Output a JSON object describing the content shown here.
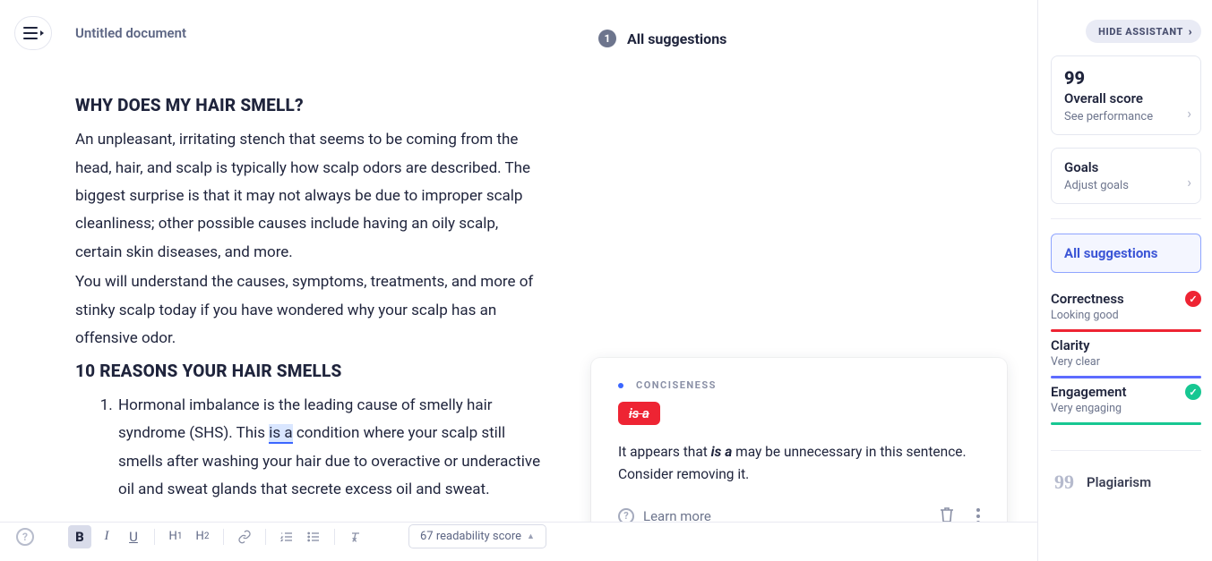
{
  "doc_title": "Untitled document",
  "suggestions_header": {
    "count": "1",
    "label": "All suggestions"
  },
  "editor": {
    "h1": "WHY DOES MY HAIR SMELL?",
    "p1": "An unpleasant, irritating stench that seems to be coming from the head, hair, and scalp is typically how scalp odors are described. The biggest surprise is that it may not always be due to improper scalp cleanliness; other possible causes include having an oily scalp, certain skin diseases, and more.",
    "p2": "You will understand the causes, symptoms, treatments, and more of stinky scalp today if you have wondered why your scalp has an offensive odor.",
    "h2": "10 REASONS YOUR HAIR SMELLS",
    "li1_a": "Hormonal imbalance is the leading cause of smelly hair syndrome (SHS). This ",
    "li1_hl": "is a",
    "li1_b": " condition where your scalp still smells after washing your hair due to overactive or underactive oil and sweat glands that secrete excess oil and sweat."
  },
  "card": {
    "tag": "CONCISENESS",
    "chip": "is a",
    "desc_a": "It appears that ",
    "desc_em": "is a",
    "desc_b": " may be unnecessary in this sentence. Consider removing it.",
    "learn": "Learn more"
  },
  "right": {
    "hide": "HIDE ASSISTANT",
    "score": {
      "big": "99",
      "mid": "Overall score",
      "sub": "See performance"
    },
    "goals": {
      "mid": "Goals",
      "sub": "Adjust goals"
    },
    "all_suggestions": "All suggestions",
    "cats": [
      {
        "name": "Correctness",
        "sub": "Looking good",
        "bar": "#ee2433",
        "icon": "check-red"
      },
      {
        "name": "Clarity",
        "sub": "Very clear",
        "bar": "#5d6bff",
        "icon": ""
      },
      {
        "name": "Engagement",
        "sub": "Very engaging",
        "bar": "#17c792",
        "icon": "check-green"
      }
    ],
    "plagiarism": "Plagiarism"
  },
  "toolbar": {
    "bold": "B",
    "italic": "I",
    "underline": "U",
    "h1": "H1",
    "h2": "H2",
    "readability": "67 readability score"
  }
}
